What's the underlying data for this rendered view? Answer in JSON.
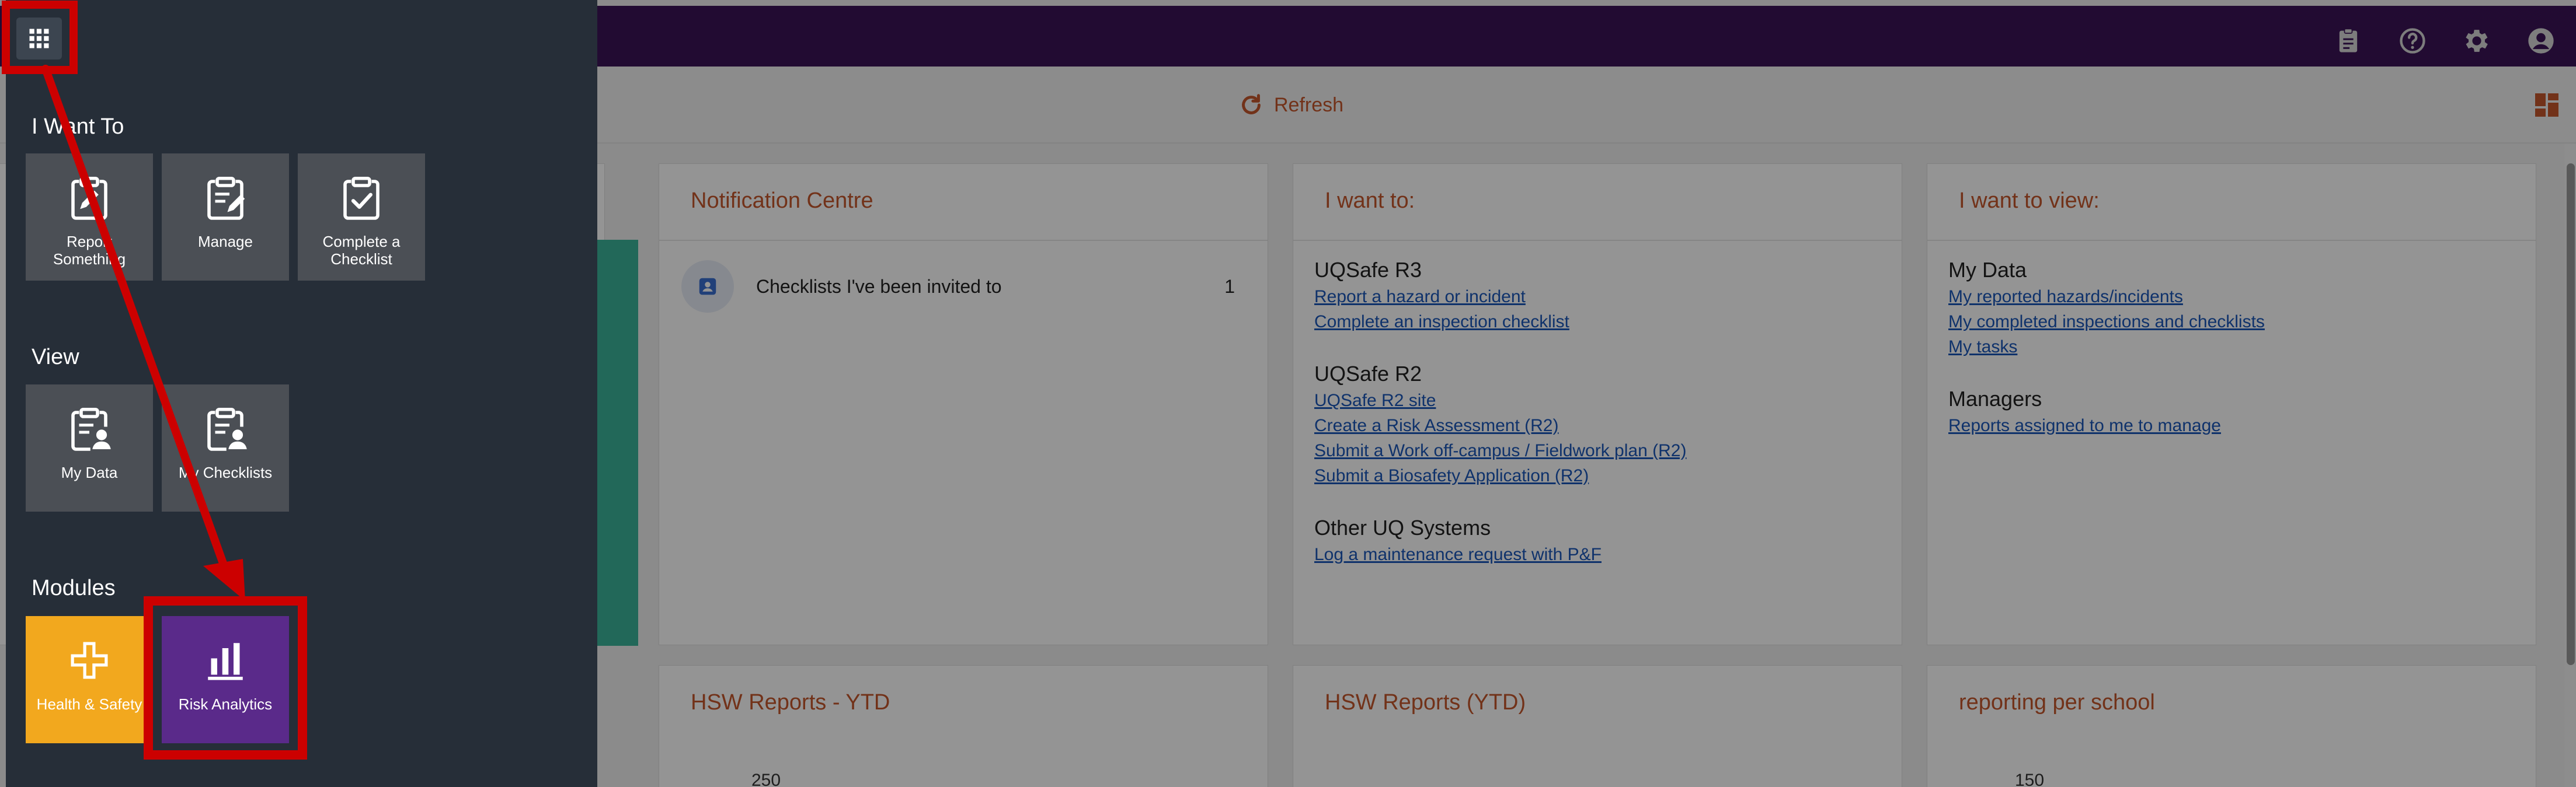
{
  "colors": {
    "topbar": "#3b1357",
    "accent": "#c4562c",
    "link": "#1a56b8",
    "drawer": "#262e38",
    "tile": "#4b4f55",
    "health_tile": "#f2a81e",
    "risk_tile": "#5a2a8a",
    "annotation": "#cc0000"
  },
  "topbar": {
    "icons": [
      "clipboard-icon",
      "help-icon",
      "gear-icon",
      "account-icon"
    ]
  },
  "toolbar": {
    "refresh_label": "Refresh"
  },
  "cards": {
    "notification": {
      "title": "Notification Centre",
      "items": [
        {
          "label": "Checklists I've been invited to",
          "count": "1"
        }
      ]
    },
    "want_to": {
      "title": "I want to:",
      "groups": [
        {
          "title": "UQSafe R3",
          "links": [
            "Report a hazard or incident",
            "Complete an inspection checklist"
          ]
        },
        {
          "title": "UQSafe R2",
          "links": [
            "UQSafe R2 site",
            "Create a Risk Assessment (R2)",
            "Submit a Work off-campus / Fieldwork plan (R2)",
            "Submit a Biosafety Application (R2)"
          ]
        },
        {
          "title": "Other UQ Systems",
          "links": [
            "Log a maintenance request with P&F"
          ]
        }
      ]
    },
    "want_to_view": {
      "title": "I want to view:",
      "groups": [
        {
          "title": "My Data",
          "links": [
            "My reported hazards/incidents",
            "My completed inspections and checklists",
            "My tasks"
          ]
        },
        {
          "title": "Managers",
          "links": [
            "Reports assigned to me to manage"
          ]
        }
      ]
    },
    "bottom": [
      {
        "title": "HSW Reports - YTD",
        "tick": "250"
      },
      {
        "title": "HSW Reports (YTD)",
        "tick": ""
      },
      {
        "title": "reporting per school",
        "tick": "150"
      }
    ]
  },
  "drawer": {
    "sections": {
      "i_want_to": {
        "title": "I Want To",
        "tiles": [
          {
            "label": "Report Something",
            "icon": "clipboard-pen-icon"
          },
          {
            "label": "Manage",
            "icon": "clipboard-edit-icon"
          },
          {
            "label": "Complete a Checklist",
            "icon": "clipboard-check-icon"
          }
        ]
      },
      "view": {
        "title": "View",
        "tiles": [
          {
            "label": "My Data",
            "icon": "clipboard-person-icon"
          },
          {
            "label": "My Checklists",
            "icon": "clipboard-person-icon"
          }
        ]
      },
      "modules": {
        "title": "Modules",
        "tiles": [
          {
            "label": "Health & Safety",
            "icon": "cross-icon"
          },
          {
            "label": "Risk Analytics",
            "icon": "bar-chart-icon"
          }
        ]
      }
    }
  }
}
